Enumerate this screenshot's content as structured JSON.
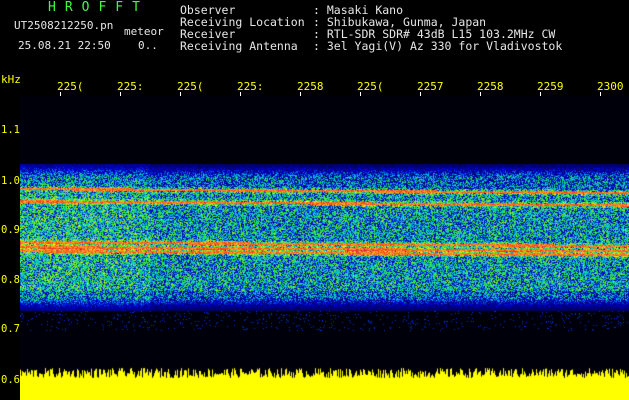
{
  "app": {
    "brand": "HROFFT",
    "file_name": "UT2508212250.pn",
    "tag": "meteor",
    "date_time": "25.08.21 22:50",
    "count": "0.."
  },
  "header": {
    "rows": [
      {
        "label": "Observer",
        "value": "Masaki Kano"
      },
      {
        "label": "Receiving Location",
        "value": "Shibukawa, Gunma, Japan"
      },
      {
        "label": "Receiver",
        "value": "RTL-SDR SDR# 43dB L15 103.2MHz CW"
      },
      {
        "label": "Receiving Antenna",
        "value": "3el Yagi(V) Az 330 for Vladivostok"
      }
    ]
  },
  "axis": {
    "y_unit": "kHz",
    "y_ticks": [
      "1.1",
      "1.0",
      "0.9",
      "0.8",
      "0.7",
      "0.6"
    ],
    "x_ticks": [
      "225(",
      "225:",
      "225(",
      "225:",
      "2258",
      "225(",
      "2257",
      "2258",
      "2259",
      "2300"
    ]
  },
  "colors": {
    "background": "#000000",
    "axis_text": "#ffff00",
    "brand": "#3cff3c",
    "header_text": "#e6e6e6",
    "echo_line": "#ff3a3a"
  },
  "spectrum": {
    "y_range_khz": [
      0.6,
      1.15
    ],
    "noise_band_khz": [
      0.76,
      1.02
    ],
    "echo_lines_khz": [
      0.985,
      0.96,
      0.878,
      0.868,
      0.86
    ]
  }
}
